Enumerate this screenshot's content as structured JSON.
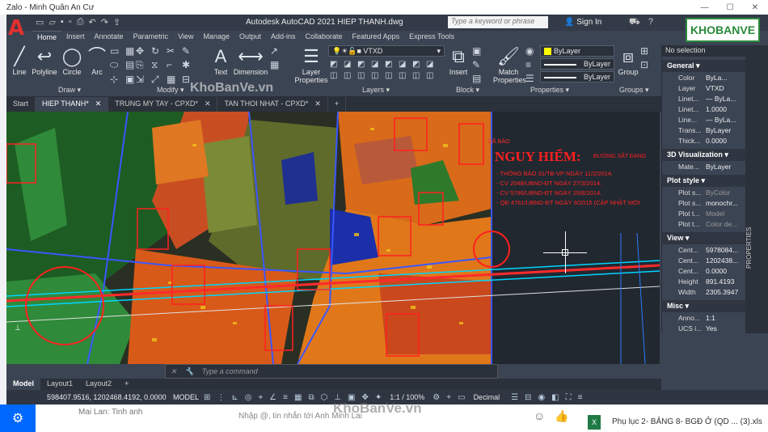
{
  "zalo": {
    "title": "Zalo - Minh Quân An Cư",
    "contact_name": "Mai Lan: Tinh anh",
    "input_placeholder": "Nhập @, tin nhắn tới Anh Minh Lai",
    "file_name": "Phụ lục 2- BẢNG 8- BGĐ Ở (QD ... (3).xls"
  },
  "app": {
    "title": "Autodesk AutoCAD 2021   HIEP THANH.dwg",
    "search_placeholder": "Type a keyword or phrase",
    "signin": "Sign In"
  },
  "menu": [
    "Home",
    "Insert",
    "Annotate",
    "Parametric",
    "View",
    "Manage",
    "Output",
    "Add-ins",
    "Collaborate",
    "Featured Apps",
    "Express Tools"
  ],
  "ribbon": {
    "draw": {
      "line": "Line",
      "polyline": "Polyline",
      "circle": "Circle",
      "arc": "Arc",
      "label": "Draw"
    },
    "modify": {
      "label": "Modify"
    },
    "annotation": {
      "text": "Text",
      "dimension": "Dimension",
      "label": "Annotation"
    },
    "layers": {
      "layer_properties": "Layer Properties",
      "current_layer": "VTXD",
      "label": "Layers"
    },
    "block": {
      "insert": "Insert",
      "label": "Block"
    },
    "properties": {
      "match": "Match Properties",
      "color": "ByLayer",
      "linetype": "ByLayer",
      "lineweight": "ByLayer",
      "label": "Properties"
    },
    "groups": {
      "group": "Group",
      "label": "Groups"
    }
  },
  "file_tabs": [
    "Start",
    "HIEP THANH*",
    "TRUNG MY TAY - CPXD*",
    "TAN THOI NHAT - CPXD*"
  ],
  "drawing": {
    "warning_title": "NGUY HIỂM:",
    "warning_sub": "ĐƯỜNG SẮT ĐANG",
    "warning_top": "DÃ BÁO",
    "warning_lines": [
      "- THÔNG BÁO 31/TB-VP NGÀY 11/2/2014.",
      "- CV 2048/UBND-ĐT NGÀY 27/3/2014.",
      "- CV 5796/UBND-ĐT NGÀY 25/8/2014.",
      "- QĐ 4761/UBND-ĐT NGÀY 9/2015 (CẬP NHẬT MỚI"
    ]
  },
  "command": {
    "placeholder": "Type  a  command"
  },
  "layout_tabs": [
    "Model",
    "Layout1",
    "Layout2"
  ],
  "status": {
    "coords": "598407.9516, 1202468.4192, 0.0000",
    "model": "MODEL",
    "scale": "1:1 / 100%",
    "units": "Decimal"
  },
  "properties": {
    "selection": "No selection",
    "general_title": "General",
    "general": [
      {
        "k": "Color",
        "v": "ByLa..."
      },
      {
        "k": "Layer",
        "v": "VTXD"
      },
      {
        "k": "Linet...",
        "v": "— ByLa..."
      },
      {
        "k": "Linet...",
        "v": "1.0000"
      },
      {
        "k": "Line...",
        "v": "— ByLa..."
      },
      {
        "k": "Trans...",
        "v": "ByLayer"
      },
      {
        "k": "Thick...",
        "v": "0.0000"
      }
    ],
    "viz_title": "3D Visualization",
    "viz": [
      {
        "k": "Mate...",
        "v": "ByLayer"
      }
    ],
    "plot_title": "Plot style",
    "plot": [
      {
        "k": "Plot s...",
        "v": "ByColor"
      },
      {
        "k": "Plot s...",
        "v": "monochr..."
      },
      {
        "k": "Plot t...",
        "v": "Model"
      },
      {
        "k": "Plot t...",
        "v": "Color de..."
      }
    ],
    "view_title": "View",
    "view": [
      {
        "k": "Cent...",
        "v": "5978084..."
      },
      {
        "k": "Cent...",
        "v": "1202438..."
      },
      {
        "k": "Cent...",
        "v": "0.0000"
      },
      {
        "k": "Height",
        "v": "891.4193"
      },
      {
        "k": "Width",
        "v": "2305.3947"
      }
    ],
    "misc_title": "Misc",
    "misc": [
      {
        "k": "Anno...",
        "v": "1:1"
      },
      {
        "k": "UCS i...",
        "v": "Yes"
      }
    ],
    "side_label": "PROPERTIES"
  },
  "watermark": "KhoBanVe.vn",
  "watermark_logo": "KHOBANVE"
}
